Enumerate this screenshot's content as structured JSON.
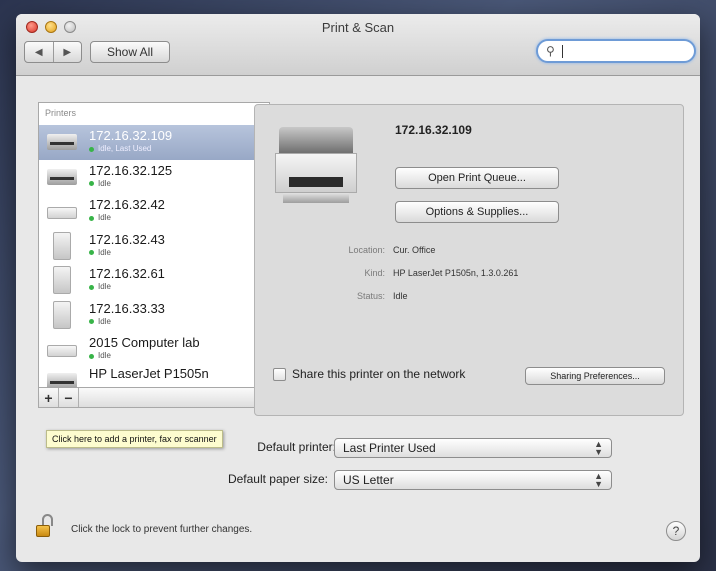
{
  "window": {
    "title": "Print & Scan"
  },
  "toolbar": {
    "back_icon": "◀",
    "forward_icon": "▶",
    "show_all_label": "Show All",
    "search_value": ""
  },
  "printers": {
    "header": "Printers",
    "items": [
      {
        "name": "172.16.32.109",
        "status": "Idle, Last Used",
        "selected": true
      },
      {
        "name": "172.16.32.125",
        "status": "Idle"
      },
      {
        "name": "172.16.32.42",
        "status": "Idle"
      },
      {
        "name": "172.16.32.43",
        "status": "Idle"
      },
      {
        "name": "172.16.32.61",
        "status": "Idle"
      },
      {
        "name": "172.16.33.33",
        "status": "Idle"
      },
      {
        "name": "2015 Computer lab",
        "status": "Idle"
      },
      {
        "name": "HP LaserJet P1505n",
        "status": ""
      }
    ],
    "add_label": "+",
    "remove_label": "−"
  },
  "detail": {
    "name": "172.16.32.109",
    "open_queue_label": "Open Print Queue...",
    "options_label": "Options & Supplies...",
    "location_label": "Location:",
    "location_value": "Cur. Office",
    "kind_label": "Kind:",
    "kind_value": "HP LaserJet P1505n, 1.3.0.261",
    "status_label": "Status:",
    "status_value": "Idle",
    "share_label": "Share this printer on the network",
    "sharing_prefs_label": "Sharing Preferences..."
  },
  "defaults": {
    "printer_label": "Default printer:",
    "printer_value": "Last Printer Used",
    "paper_label": "Default paper size:",
    "paper_value": "US Letter"
  },
  "tooltip": "Click here to add a printer, fax or scanner",
  "footer": {
    "lock_text": "Click the lock to prevent further changes.",
    "help_label": "?"
  },
  "colors": {
    "selection": "#98a8c6",
    "idle_dot": "#38b448",
    "tooltip_bg": "#fdfccf"
  }
}
